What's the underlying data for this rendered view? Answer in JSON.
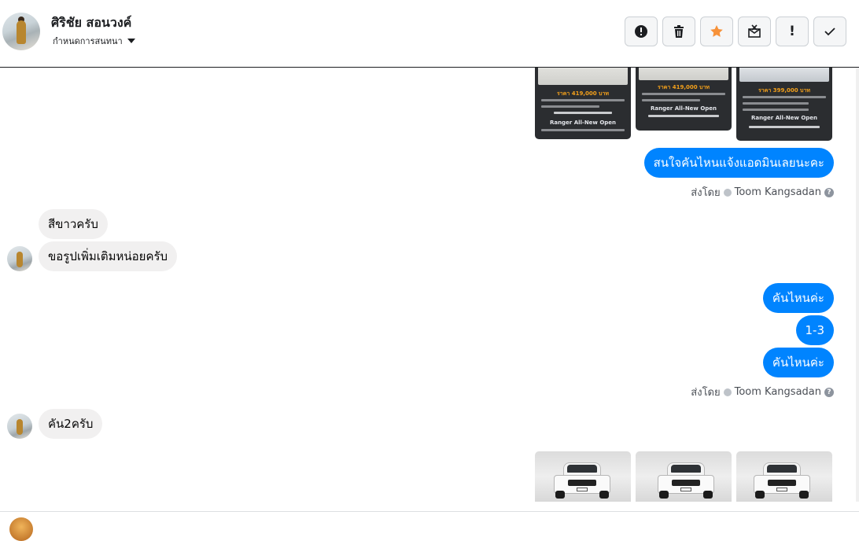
{
  "header": {
    "contact_name": "ศิริชัย สอนวงค์",
    "assign_label": "กำหนดการสนทนา",
    "toolbar": [
      {
        "name": "report-spam-button",
        "icon": "exclamation-circle-icon",
        "glyph": ""
      },
      {
        "name": "delete-button",
        "icon": "trash-icon",
        "glyph": ""
      },
      {
        "name": "star-button",
        "icon": "star-icon",
        "glyph": ""
      },
      {
        "name": "mark-unread-button",
        "icon": "envelope-x-icon",
        "glyph": ""
      },
      {
        "name": "mark-important-button",
        "icon": "exclamation-icon",
        "glyph": "!"
      },
      {
        "name": "mark-done-button",
        "icon": "check-icon",
        "glyph": ""
      }
    ]
  },
  "thread": {
    "sent_by_label": "ส่งโดย",
    "agent_name": "Toom Kangsadan",
    "listing_cards": [
      {
        "price": "ราคา 419,000 บาท",
        "model": "Ranger All-New Open"
      },
      {
        "price": "ราคา 419,000 บาท",
        "model": "Ranger All-New Open"
      },
      {
        "price": "ราคา 399,000 บาท",
        "model": "Ranger All-New Open"
      }
    ],
    "messages": [
      {
        "text": "สนใจคันไหนแจ้งแอดมินเลยนะคะ"
      },
      {
        "text": "สีขาวครับ"
      },
      {
        "text": "ขอรูปเพิ่มเติมหน่อยครับ"
      },
      {
        "text": "คันไหนค่ะ"
      },
      {
        "text": "1-3"
      },
      {
        "text": "คันไหนค่ะ"
      },
      {
        "text": "คัน2ครับ"
      }
    ]
  },
  "colors": {
    "outgoing_bubble": "#0084ff",
    "incoming_bubble": "#f1f0f0",
    "star": "#f7923a"
  }
}
